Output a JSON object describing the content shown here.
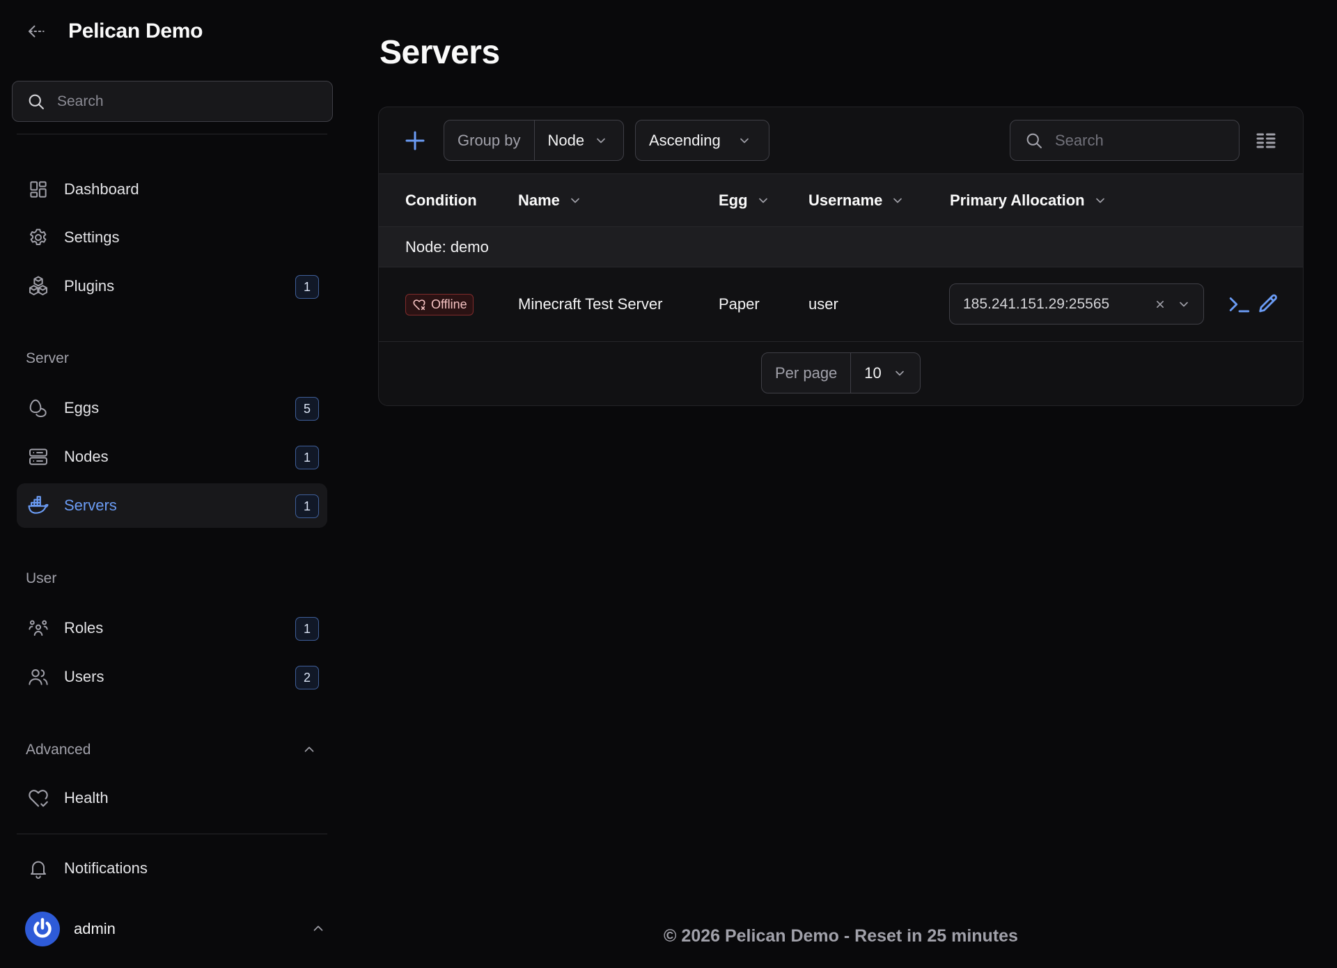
{
  "app": {
    "title": "Pelican Demo"
  },
  "sidebar": {
    "search_placeholder": "Search",
    "items": [
      {
        "label": "Dashboard"
      },
      {
        "label": "Settings"
      },
      {
        "label": "Plugins",
        "badge": "1"
      }
    ],
    "groups": [
      {
        "label": "Server",
        "items": [
          {
            "label": "Eggs",
            "badge": "5"
          },
          {
            "label": "Nodes",
            "badge": "1"
          },
          {
            "label": "Servers",
            "badge": "1",
            "active": true
          }
        ]
      },
      {
        "label": "User",
        "items": [
          {
            "label": "Roles",
            "badge": "1"
          },
          {
            "label": "Users",
            "badge": "2"
          }
        ]
      },
      {
        "label": "Advanced",
        "items": [
          {
            "label": "Health"
          }
        ]
      }
    ],
    "notifications_label": "Notifications",
    "user": {
      "name": "admin"
    }
  },
  "main": {
    "title": "Servers",
    "toolbar": {
      "group_by_label": "Group by",
      "group_by_value": "Node",
      "sort_value": "Ascending",
      "search_placeholder": "Search"
    },
    "table": {
      "columns": [
        "Condition",
        "Name",
        "Egg",
        "Username",
        "Primary Allocation"
      ],
      "group_label": "Node: demo",
      "rows": [
        {
          "condition": "Offline",
          "name": "Minecraft Test Server",
          "egg": "Paper",
          "username": "user",
          "allocation": "185.241.151.29:25565"
        }
      ]
    },
    "pagination": {
      "per_page_label": "Per page",
      "per_page_value": "10"
    }
  },
  "footer": {
    "text": "© 2026 Pelican Demo - Reset in 25 minutes"
  },
  "colors": {
    "accent": "#6b9cf5",
    "background": "#09090b",
    "danger": "#7f2b2b"
  }
}
